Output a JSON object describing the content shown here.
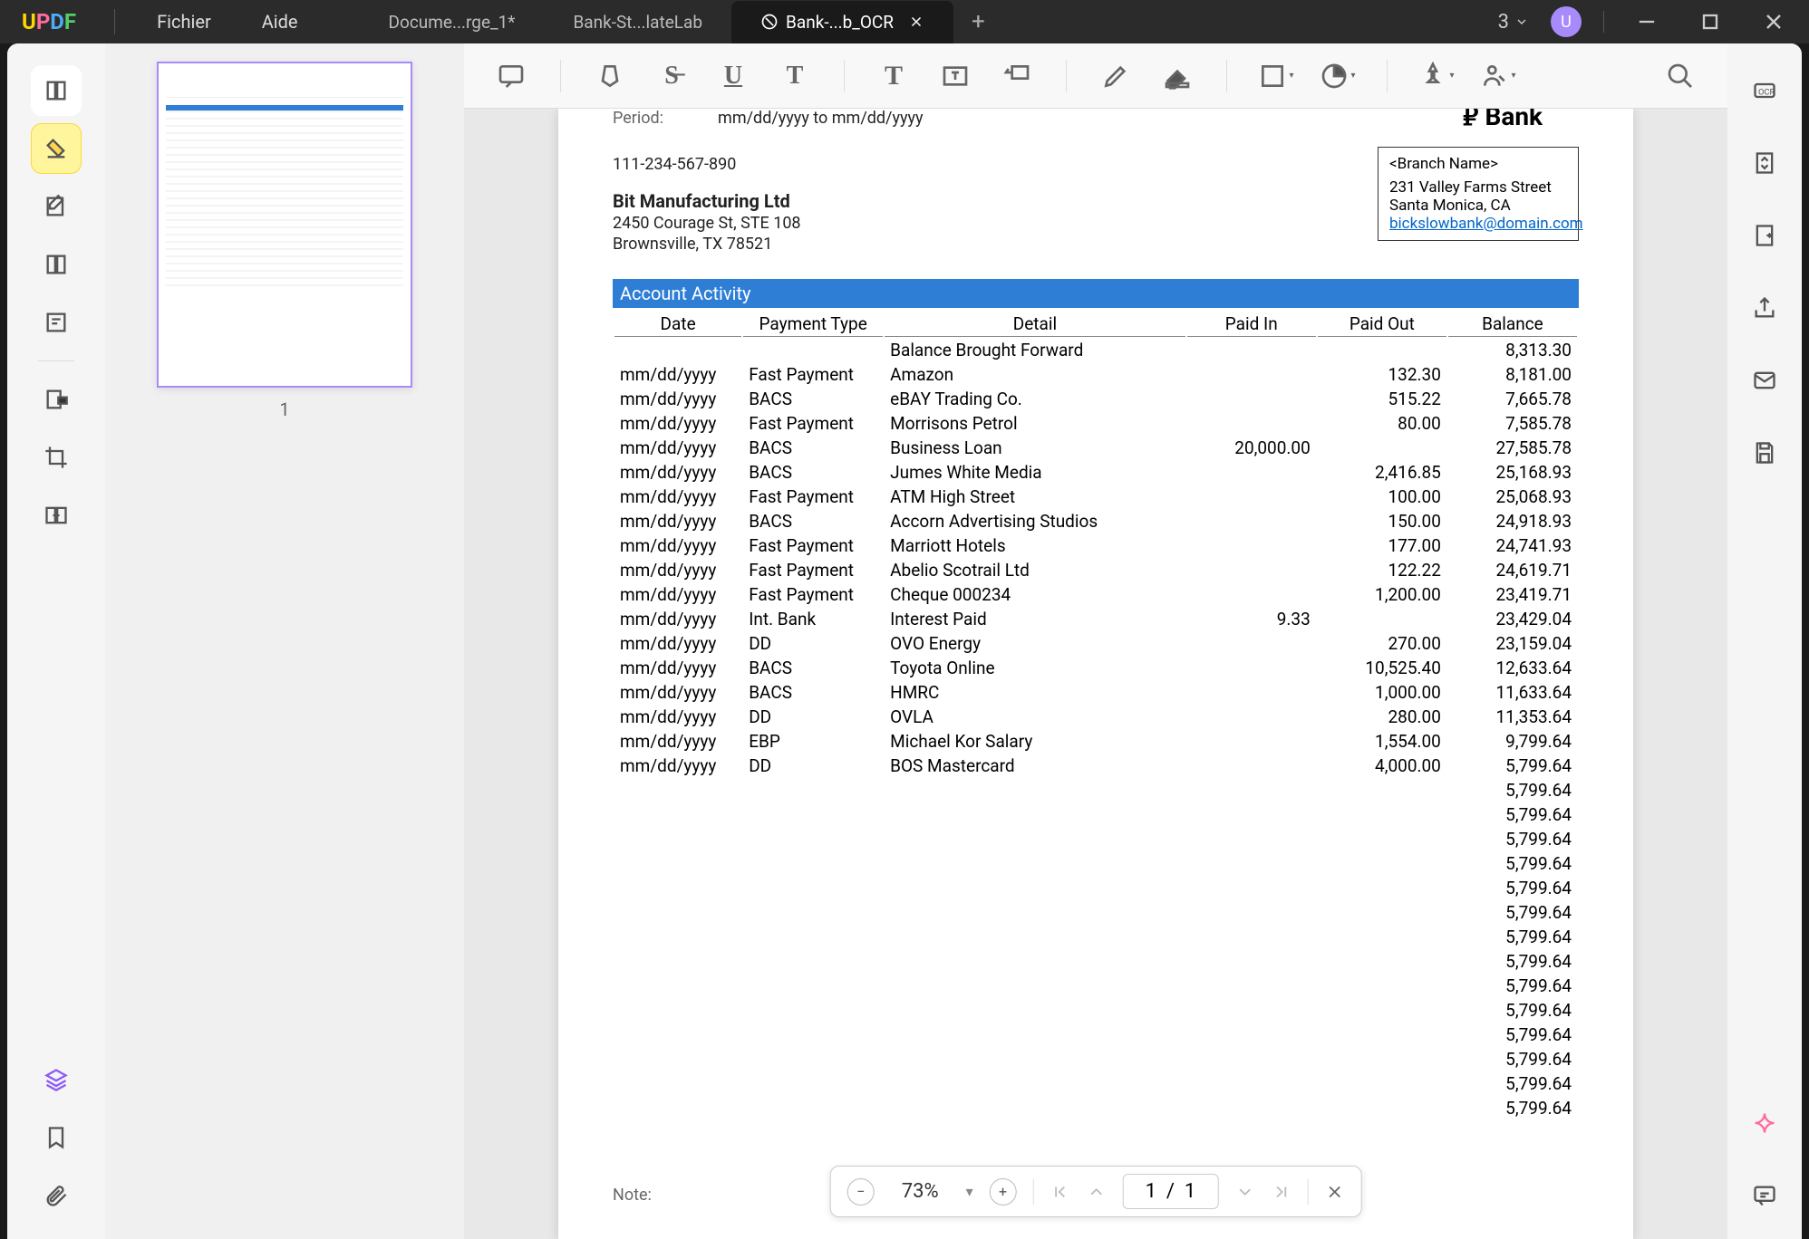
{
  "app": {
    "logo_u": "U",
    "logo_p": "P",
    "logo_d": "D",
    "logo_f": "F"
  },
  "menu": {
    "file": "Fichier",
    "help": "Aide"
  },
  "tabs": [
    {
      "label": "Docume...rge_1*"
    },
    {
      "label": "Bank-St...lateLab"
    },
    {
      "label": "Bank-...b_OCR"
    }
  ],
  "tab_add": "+",
  "cloud": {
    "count": "3"
  },
  "avatar_letter": "U",
  "thumbnail": {
    "page_num": "1"
  },
  "doc": {
    "period_label": "Period:",
    "period_value": "mm/dd/yyyy to mm/dd/yyyy",
    "phone": "111-234-567-890",
    "company": "Bit Manufacturing Ltd",
    "addr1": "2450 Courage St, STE 108",
    "addr2": "Brownsville, TX 78521",
    "bank_name": "Bank",
    "branch_name": "<Branch Name>",
    "branch_addr1": "231 Valley Farms Street",
    "branch_addr2": "Santa Monica, CA",
    "branch_email": "bickslowbank@domain.com",
    "activity_title": "Account Activity",
    "headers": {
      "date": "Date",
      "type": "Payment Type",
      "detail": "Detail",
      "paid_in": "Paid In",
      "paid_out": "Paid Out",
      "balance": "Balance"
    },
    "rows": [
      {
        "date": "",
        "type": "",
        "detail": "Balance Brought Forward",
        "in": "",
        "out": "",
        "bal": "8,313.30"
      },
      {
        "date": "mm/dd/yyyy",
        "type": "Fast Payment",
        "detail": "Amazon",
        "in": "",
        "out": "132.30",
        "bal": "8,181.00"
      },
      {
        "date": "mm/dd/yyyy",
        "type": "BACS",
        "detail": "eBAY Trading Co.",
        "in": "",
        "out": "515.22",
        "bal": "7,665.78"
      },
      {
        "date": "mm/dd/yyyy",
        "type": "Fast Payment",
        "detail": "Morrisons Petrol",
        "in": "",
        "out": "80.00",
        "bal": "7,585.78"
      },
      {
        "date": "mm/dd/yyyy",
        "type": "BACS",
        "detail": "Business Loan",
        "in": "20,000.00",
        "out": "",
        "bal": "27,585.78"
      },
      {
        "date": "mm/dd/yyyy",
        "type": "BACS",
        "detail": "Jumes White Media",
        "in": "",
        "out": "2,416.85",
        "bal": "25,168.93"
      },
      {
        "date": "mm/dd/yyyy",
        "type": "Fast Payment",
        "detail": "ATM High Street",
        "in": "",
        "out": "100.00",
        "bal": "25,068.93"
      },
      {
        "date": "mm/dd/yyyy",
        "type": "BACS",
        "detail": "Accorn Advertising Studios",
        "in": "",
        "out": "150.00",
        "bal": "24,918.93"
      },
      {
        "date": "mm/dd/yyyy",
        "type": "Fast Payment",
        "detail": "Marriott Hotels",
        "in": "",
        "out": "177.00",
        "bal": "24,741.93"
      },
      {
        "date": "mm/dd/yyyy",
        "type": "Fast Payment",
        "detail": "Abelio Scotrail Ltd",
        "in": "",
        "out": "122.22",
        "bal": "24,619.71"
      },
      {
        "date": "mm/dd/yyyy",
        "type": "Fast Payment",
        "detail": "Cheque 000234",
        "in": "",
        "out": "1,200.00",
        "bal": "23,419.71"
      },
      {
        "date": "mm/dd/yyyy",
        "type": "Int. Bank",
        "detail": "Interest Paid",
        "in": "9.33",
        "out": "",
        "bal": "23,429.04"
      },
      {
        "date": "mm/dd/yyyy",
        "type": "DD",
        "detail": "OVO Energy",
        "in": "",
        "out": "270.00",
        "bal": "23,159.04"
      },
      {
        "date": "mm/dd/yyyy",
        "type": "BACS",
        "detail": "Toyota Online",
        "in": "",
        "out": "10,525.40",
        "bal": "12,633.64"
      },
      {
        "date": "mm/dd/yyyy",
        "type": "BACS",
        "detail": "HMRC",
        "in": "",
        "out": "1,000.00",
        "bal": "11,633.64"
      },
      {
        "date": "mm/dd/yyyy",
        "type": "DD",
        "detail": "OVLA",
        "in": "",
        "out": "280.00",
        "bal": "11,353.64"
      },
      {
        "date": "mm/dd/yyyy",
        "type": "EBP",
        "detail": "Michael Kor Salary",
        "in": "",
        "out": "1,554.00",
        "bal": "9,799.64"
      },
      {
        "date": "mm/dd/yyyy",
        "type": "DD",
        "detail": "BOS Mastercard",
        "in": "",
        "out": "4,000.00",
        "bal": "5,799.64"
      },
      {
        "date": "",
        "type": "",
        "detail": "",
        "in": "",
        "out": "",
        "bal": "5,799.64"
      },
      {
        "date": "",
        "type": "",
        "detail": "",
        "in": "",
        "out": "",
        "bal": "5,799.64"
      },
      {
        "date": "",
        "type": "",
        "detail": "",
        "in": "",
        "out": "",
        "bal": "5,799.64"
      },
      {
        "date": "",
        "type": "",
        "detail": "",
        "in": "",
        "out": "",
        "bal": "5,799.64"
      },
      {
        "date": "",
        "type": "",
        "detail": "",
        "in": "",
        "out": "",
        "bal": "5,799.64"
      },
      {
        "date": "",
        "type": "",
        "detail": "",
        "in": "",
        "out": "",
        "bal": "5,799.64"
      },
      {
        "date": "",
        "type": "",
        "detail": "",
        "in": "",
        "out": "",
        "bal": "5,799.64"
      },
      {
        "date": "",
        "type": "",
        "detail": "",
        "in": "",
        "out": "",
        "bal": "5,799.64"
      },
      {
        "date": "",
        "type": "",
        "detail": "",
        "in": "",
        "out": "",
        "bal": "5,799.64"
      },
      {
        "date": "",
        "type": "",
        "detail": "",
        "in": "",
        "out": "",
        "bal": "5,799.64"
      },
      {
        "date": "",
        "type": "",
        "detail": "",
        "in": "",
        "out": "",
        "bal": "5,799.64"
      },
      {
        "date": "",
        "type": "",
        "detail": "",
        "in": "",
        "out": "",
        "bal": "5,799.64"
      },
      {
        "date": "",
        "type": "",
        "detail": "",
        "in": "",
        "out": "",
        "bal": "5,799.64"
      },
      {
        "date": "",
        "type": "",
        "detail": "",
        "in": "",
        "out": "",
        "bal": "5,799.64"
      }
    ],
    "note_label": "Note:"
  },
  "bottombar": {
    "zoom": "73%",
    "page": "1",
    "sep": "/",
    "total": "1"
  }
}
